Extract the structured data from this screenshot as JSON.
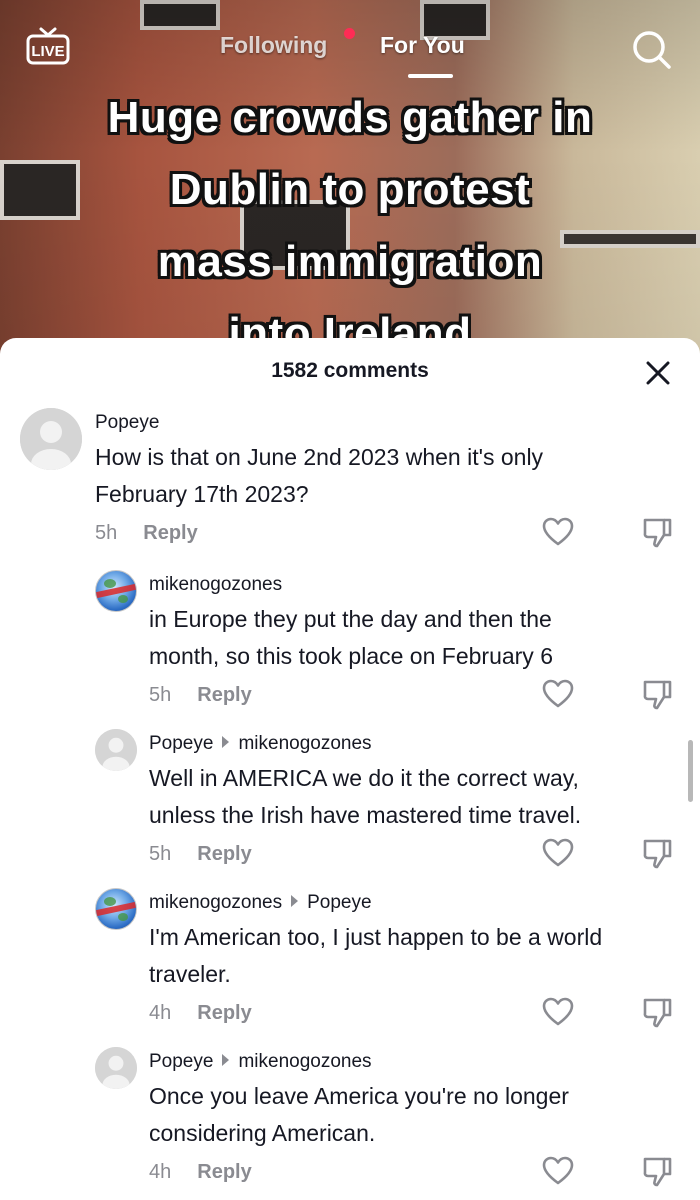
{
  "nav": {
    "live_label": "LIVE",
    "following_label": "Following",
    "for_you_label": "For You"
  },
  "video": {
    "caption_lines": [
      "Huge crowds gather in",
      "Dublin to protest",
      "mass immigration",
      "into Ireland"
    ]
  },
  "sheet": {
    "comment_count": "1582 comments"
  },
  "comments": [
    {
      "username": "Popeye",
      "reply_to": "",
      "text_lines": [
        "How is that on June 2nd 2023 when it's only",
        "February 17th 2023?"
      ],
      "time": "5h",
      "reply_label": "Reply",
      "avatar": "gray"
    },
    {
      "username": "mikenogozones",
      "reply_to": "",
      "text_lines": [
        "in Europe they put the day and then the",
        "month, so this took place on February 6"
      ],
      "time": "5h",
      "reply_label": "Reply",
      "avatar": "globe"
    },
    {
      "username": "Popeye",
      "reply_to": "mikenogozones",
      "text_lines": [
        "Well in AMERICA we do it the correct way,",
        "unless the Irish have mastered time travel."
      ],
      "time": "5h",
      "reply_label": "Reply",
      "avatar": "gray"
    },
    {
      "username": "mikenogozones",
      "reply_to": "Popeye",
      "text_lines": [
        "I'm American too, I just happen to be a world",
        "traveler."
      ],
      "time": "4h",
      "reply_label": "Reply",
      "avatar": "globe"
    },
    {
      "username": "Popeye",
      "reply_to": "mikenogozones",
      "text_lines": [
        "Once you leave America you're no longer",
        "considering American."
      ],
      "time": "4h",
      "reply_label": "Reply",
      "avatar": "gray"
    }
  ]
}
